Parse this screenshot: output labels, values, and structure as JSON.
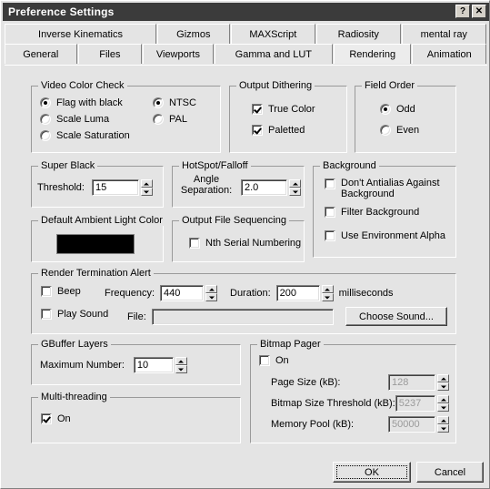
{
  "window": {
    "title": "Preference Settings",
    "help_button": "?",
    "close_button": "✕"
  },
  "tabs": {
    "row1": [
      {
        "label": "Inverse Kinematics",
        "selected": false
      },
      {
        "label": "Gizmos",
        "selected": false
      },
      {
        "label": "MAXScript",
        "selected": false
      },
      {
        "label": "Radiosity",
        "selected": false
      },
      {
        "label": "mental ray",
        "selected": false
      }
    ],
    "row2": [
      {
        "label": "General",
        "selected": false
      },
      {
        "label": "Files",
        "selected": false
      },
      {
        "label": "Viewports",
        "selected": false
      },
      {
        "label": "Gamma and LUT",
        "selected": false
      },
      {
        "label": "Rendering",
        "selected": true
      },
      {
        "label": "Animation",
        "selected": false
      }
    ]
  },
  "video_color_check": {
    "title": "Video Color Check",
    "options": [
      {
        "label": "Flag with black",
        "checked": true
      },
      {
        "label": "Scale Luma",
        "checked": false
      },
      {
        "label": "Scale Saturation",
        "checked": false
      }
    ],
    "standards": [
      {
        "label": "NTSC",
        "checked": true
      },
      {
        "label": "PAL",
        "checked": false
      }
    ]
  },
  "output_dithering": {
    "title": "Output Dithering",
    "options": [
      {
        "label": "True Color",
        "checked": true
      },
      {
        "label": "Paletted",
        "checked": true
      }
    ]
  },
  "field_order": {
    "title": "Field Order",
    "options": [
      {
        "label": "Odd",
        "checked": true
      },
      {
        "label": "Even",
        "checked": false
      }
    ]
  },
  "super_black": {
    "title": "Super Black",
    "threshold_label": "Threshold:",
    "threshold_value": "15"
  },
  "hotspot_falloff": {
    "title": "HotSpot/Falloff",
    "angle_label_line1": "Angle",
    "angle_label_line2": "Separation:",
    "angle_value": "2.0"
  },
  "background": {
    "title": "Background",
    "options": [
      {
        "label": "Don't Antialias Against Background",
        "checked": false
      },
      {
        "label": "Filter Background",
        "checked": false
      },
      {
        "label": "Use Environment Alpha",
        "checked": false
      }
    ]
  },
  "default_ambient_light_color": {
    "title": "Default Ambient Light Color",
    "swatch_color": "#000000"
  },
  "output_file_sequencing": {
    "title": "Output File Sequencing",
    "options": [
      {
        "label": "Nth Serial Numbering",
        "checked": false
      }
    ]
  },
  "render_termination_alert": {
    "title": "Render Termination Alert",
    "beep_label": "Beep",
    "beep_checked": false,
    "frequency_label": "Frequency:",
    "frequency_value": "440",
    "duration_label": "Duration:",
    "duration_value": "200",
    "duration_units": "milliseconds",
    "play_sound_label": "Play Sound",
    "play_sound_checked": false,
    "file_label": "File:",
    "file_value": "",
    "choose_sound_label": "Choose Sound..."
  },
  "gbuffer_layers": {
    "title": "GBuffer Layers",
    "maximum_number_label": "Maximum Number:",
    "maximum_number_value": "10"
  },
  "multi_threading": {
    "title": "Multi-threading",
    "on_label": "On",
    "on_checked": true
  },
  "bitmap_pager": {
    "title": "Bitmap Pager",
    "on_label": "On",
    "on_checked": false,
    "rows": [
      {
        "label": "Page Size (kB):",
        "value": "128"
      },
      {
        "label": "Bitmap Size Threshold (kB):",
        "value": "5237"
      },
      {
        "label": "Memory Pool (kB):",
        "value": "50000"
      }
    ]
  },
  "buttons": {
    "ok": "OK",
    "cancel": "Cancel"
  }
}
